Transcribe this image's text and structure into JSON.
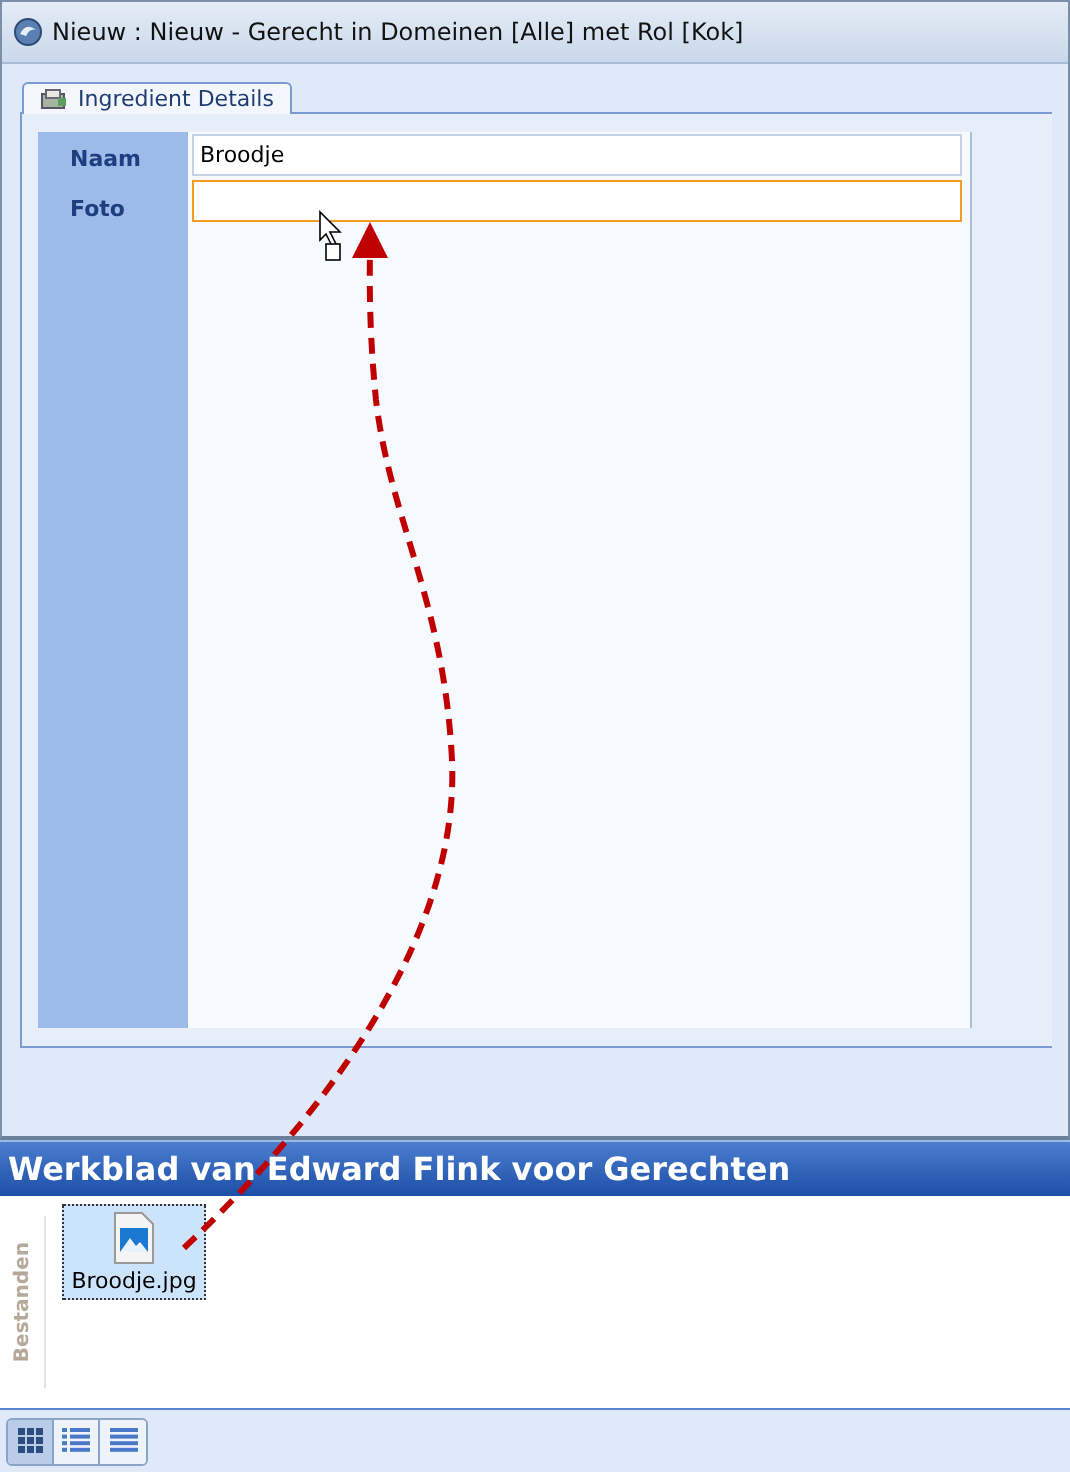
{
  "window": {
    "title": "Nieuw : Nieuw - Gerecht in Domeinen [Alle] met Rol [Kok]"
  },
  "tabs": [
    {
      "label": "Ingredient Details",
      "selected": true
    }
  ],
  "fields": [
    {
      "label": "Naam",
      "value": "Broodje",
      "focused": false
    },
    {
      "label": "Foto",
      "focused": true
    }
  ],
  "worksheet": {
    "title": "Werkblad van Edward Flink voor Gerechten",
    "side_label": "Bestanden",
    "files": [
      {
        "name": "Broodje.jpg",
        "selected": true
      }
    ]
  },
  "view_buttons": [
    {
      "kind": "large-icons",
      "selected": true
    },
    {
      "kind": "details",
      "selected": false
    },
    {
      "kind": "list",
      "selected": false
    }
  ]
}
